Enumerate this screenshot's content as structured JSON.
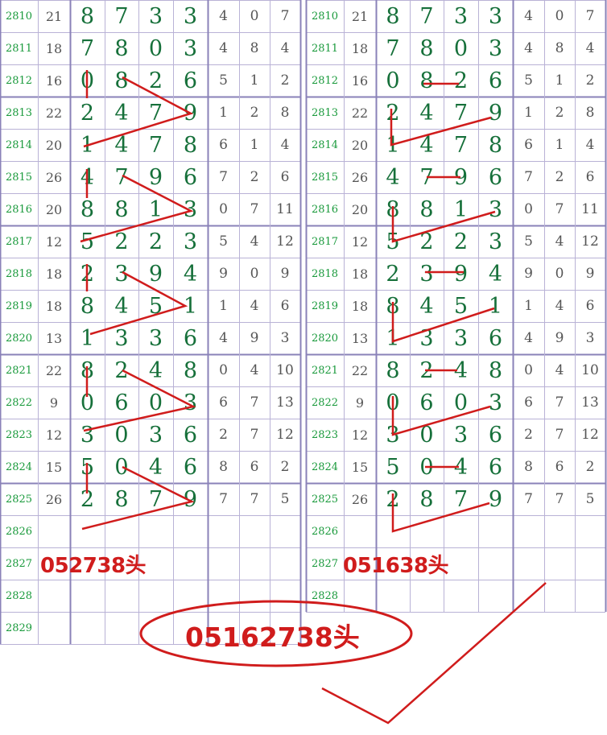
{
  "issues": [
    "2810",
    "2811",
    "2812",
    "2813",
    "2814",
    "2815",
    "2816",
    "2817",
    "2818",
    "2819",
    "2820",
    "2821",
    "2822",
    "2823",
    "2824",
    "2825",
    "2826",
    "2827",
    "2828",
    "2829"
  ],
  "left_rows": [
    {
      "sum": "21",
      "digits": [
        "8",
        "7",
        "3",
        "3"
      ],
      "extra": [
        "4",
        "0",
        "7"
      ]
    },
    {
      "sum": "18",
      "digits": [
        "7",
        "8",
        "0",
        "3"
      ],
      "extra": [
        "4",
        "8",
        "4"
      ]
    },
    {
      "sum": "16",
      "digits": [
        "0",
        "8",
        "2",
        "6"
      ],
      "extra": [
        "5",
        "1",
        "2"
      ]
    },
    {
      "sum": "22",
      "digits": [
        "2",
        "4",
        "7",
        "9"
      ],
      "extra": [
        "1",
        "2",
        "8"
      ]
    },
    {
      "sum": "20",
      "digits": [
        "1",
        "4",
        "7",
        "8"
      ],
      "extra": [
        "6",
        "1",
        "4"
      ]
    },
    {
      "sum": "26",
      "digits": [
        "4",
        "7",
        "9",
        "6"
      ],
      "extra": [
        "7",
        "2",
        "6"
      ]
    },
    {
      "sum": "20",
      "digits": [
        "8",
        "8",
        "1",
        "3"
      ],
      "extra": [
        "0",
        "7",
        "11"
      ]
    },
    {
      "sum": "12",
      "digits": [
        "5",
        "2",
        "2",
        "3"
      ],
      "extra": [
        "5",
        "4",
        "12"
      ]
    },
    {
      "sum": "18",
      "digits": [
        "2",
        "3",
        "9",
        "4"
      ],
      "extra": [
        "9",
        "0",
        "9"
      ]
    },
    {
      "sum": "18",
      "digits": [
        "8",
        "4",
        "5",
        "1"
      ],
      "extra": [
        "1",
        "4",
        "6"
      ]
    },
    {
      "sum": "13",
      "digits": [
        "1",
        "3",
        "3",
        "6"
      ],
      "extra": [
        "4",
        "9",
        "3"
      ]
    },
    {
      "sum": "22",
      "digits": [
        "8",
        "2",
        "4",
        "8"
      ],
      "extra": [
        "0",
        "4",
        "10"
      ]
    },
    {
      "sum": "9",
      "digits": [
        "0",
        "6",
        "0",
        "3"
      ],
      "extra": [
        "6",
        "7",
        "13"
      ]
    },
    {
      "sum": "12",
      "digits": [
        "3",
        "0",
        "3",
        "6"
      ],
      "extra": [
        "2",
        "7",
        "12"
      ]
    },
    {
      "sum": "15",
      "digits": [
        "5",
        "0",
        "4",
        "6"
      ],
      "extra": [
        "8",
        "6",
        "2"
      ]
    },
    {
      "sum": "26",
      "digits": [
        "2",
        "8",
        "7",
        "9"
      ],
      "extra": [
        "7",
        "7",
        "5"
      ]
    },
    {
      "sum": "",
      "digits": [
        "",
        "",
        "",
        ""
      ],
      "extra": [
        "",
        "",
        ""
      ]
    },
    {
      "sum": "",
      "digits": [
        "",
        "",
        "",
        ""
      ],
      "extra": [
        "",
        "",
        ""
      ]
    },
    {
      "sum": "",
      "digits": [
        "",
        "",
        "",
        ""
      ],
      "extra": [
        "",
        "",
        ""
      ]
    },
    {
      "sum": "",
      "digits": [
        "",
        "",
        "",
        ""
      ],
      "extra": [
        "",
        "",
        ""
      ]
    }
  ],
  "right_rows": [
    {
      "sum": "21",
      "digits": [
        "8",
        "7",
        "3",
        "3"
      ],
      "extra": [
        "4",
        "0",
        "7"
      ]
    },
    {
      "sum": "18",
      "digits": [
        "7",
        "8",
        "0",
        "3"
      ],
      "extra": [
        "4",
        "8",
        "4"
      ]
    },
    {
      "sum": "16",
      "digits": [
        "0",
        "8",
        "2",
        "6"
      ],
      "extra": [
        "5",
        "1",
        "2"
      ]
    },
    {
      "sum": "22",
      "digits": [
        "2",
        "4",
        "7",
        "9"
      ],
      "extra": [
        "1",
        "2",
        "8"
      ]
    },
    {
      "sum": "20",
      "digits": [
        "1",
        "4",
        "7",
        "8"
      ],
      "extra": [
        "6",
        "1",
        "4"
      ]
    },
    {
      "sum": "26",
      "digits": [
        "4",
        "7",
        "9",
        "6"
      ],
      "extra": [
        "7",
        "2",
        "6"
      ]
    },
    {
      "sum": "20",
      "digits": [
        "8",
        "8",
        "1",
        "3"
      ],
      "extra": [
        "0",
        "7",
        "11"
      ]
    },
    {
      "sum": "12",
      "digits": [
        "5",
        "2",
        "2",
        "3"
      ],
      "extra": [
        "5",
        "4",
        "12"
      ]
    },
    {
      "sum": "18",
      "digits": [
        "2",
        "3",
        "9",
        "4"
      ],
      "extra": [
        "9",
        "0",
        "9"
      ]
    },
    {
      "sum": "18",
      "digits": [
        "8",
        "4",
        "5",
        "1"
      ],
      "extra": [
        "1",
        "4",
        "6"
      ]
    },
    {
      "sum": "13",
      "digits": [
        "1",
        "3",
        "3",
        "6"
      ],
      "extra": [
        "4",
        "9",
        "3"
      ]
    },
    {
      "sum": "22",
      "digits": [
        "8",
        "2",
        "4",
        "8"
      ],
      "extra": [
        "0",
        "4",
        "10"
      ]
    },
    {
      "sum": "9",
      "digits": [
        "0",
        "6",
        "0",
        "3"
      ],
      "extra": [
        "6",
        "7",
        "13"
      ]
    },
    {
      "sum": "12",
      "digits": [
        "3",
        "0",
        "3",
        "6"
      ],
      "extra": [
        "2",
        "7",
        "12"
      ]
    },
    {
      "sum": "15",
      "digits": [
        "5",
        "0",
        "4",
        "6"
      ],
      "extra": [
        "8",
        "6",
        "2"
      ]
    },
    {
      "sum": "26",
      "digits": [
        "2",
        "8",
        "7",
        "9"
      ],
      "extra": [
        "7",
        "7",
        "5"
      ]
    },
    {
      "sum": "",
      "digits": [
        "",
        "",
        "",
        ""
      ],
      "extra": [
        "",
        "",
        ""
      ]
    },
    {
      "sum": "",
      "digits": [
        "",
        "",
        "",
        ""
      ],
      "extra": [
        "",
        "",
        ""
      ]
    },
    {
      "sum": "",
      "digits": [
        "",
        "",
        "",
        ""
      ],
      "extra": [
        "",
        "",
        ""
      ]
    }
  ],
  "predictions": {
    "left": "052738头",
    "right": "051638头",
    "combined": "05162738头"
  },
  "colors": {
    "grid": "#b9b2d6",
    "grid_bold": "#8a82b8",
    "issue_text": "#1a9a3c",
    "digit_text": "#16703a",
    "annotation_red": "#d01c1c"
  }
}
